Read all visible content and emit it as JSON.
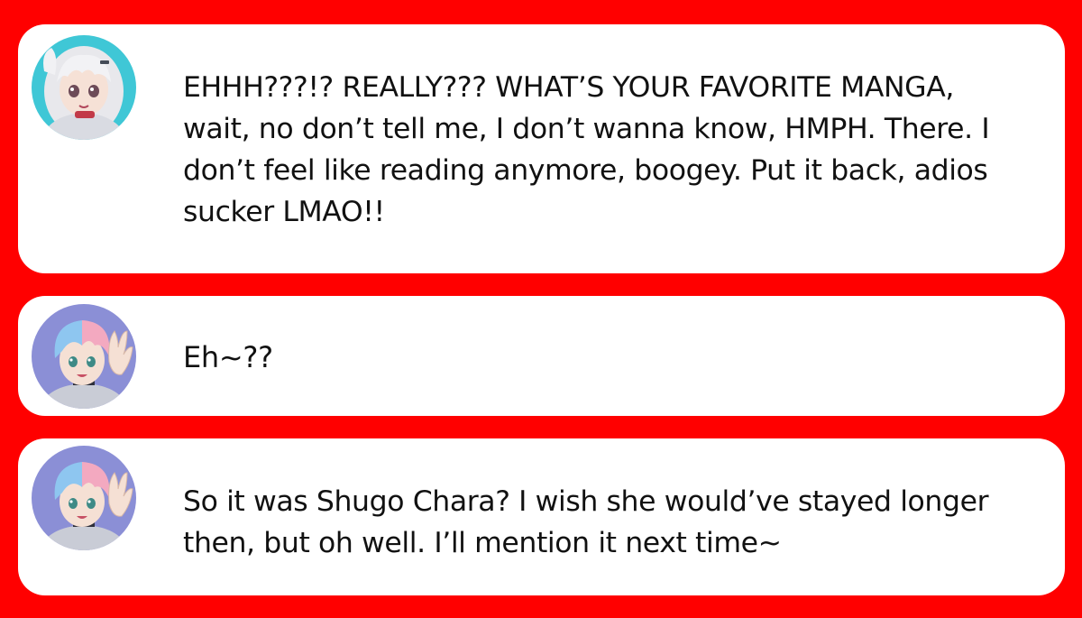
{
  "messages": [
    {
      "avatar_icon": "white-haired-girl-avatar-icon",
      "avatar_bg": "#3fc7d6",
      "text": "EHHH???!? REALLY??? WHAT’S YOUR FAVORITE MANGA, wait, no don’t tell me, I don’t wanna know, HMPH. There. I don’t feel like reading anymore, boogey. Put it back, adios sucker LMAO!!"
    },
    {
      "avatar_icon": "blue-pink-haired-boy-avatar-icon",
      "avatar_bg": "#8b8fd6",
      "text": "Eh~??"
    },
    {
      "avatar_icon": "blue-pink-haired-boy-avatar-icon",
      "avatar_bg": "#8b8fd6",
      "text": "So it was Shugo Chara? I wish she would’ve stayed longer then, but oh well. I’ll mention it next time~"
    }
  ],
  "colors": {
    "background": "#ff0000",
    "bubble": "#ffffff",
    "text": "#111111"
  }
}
